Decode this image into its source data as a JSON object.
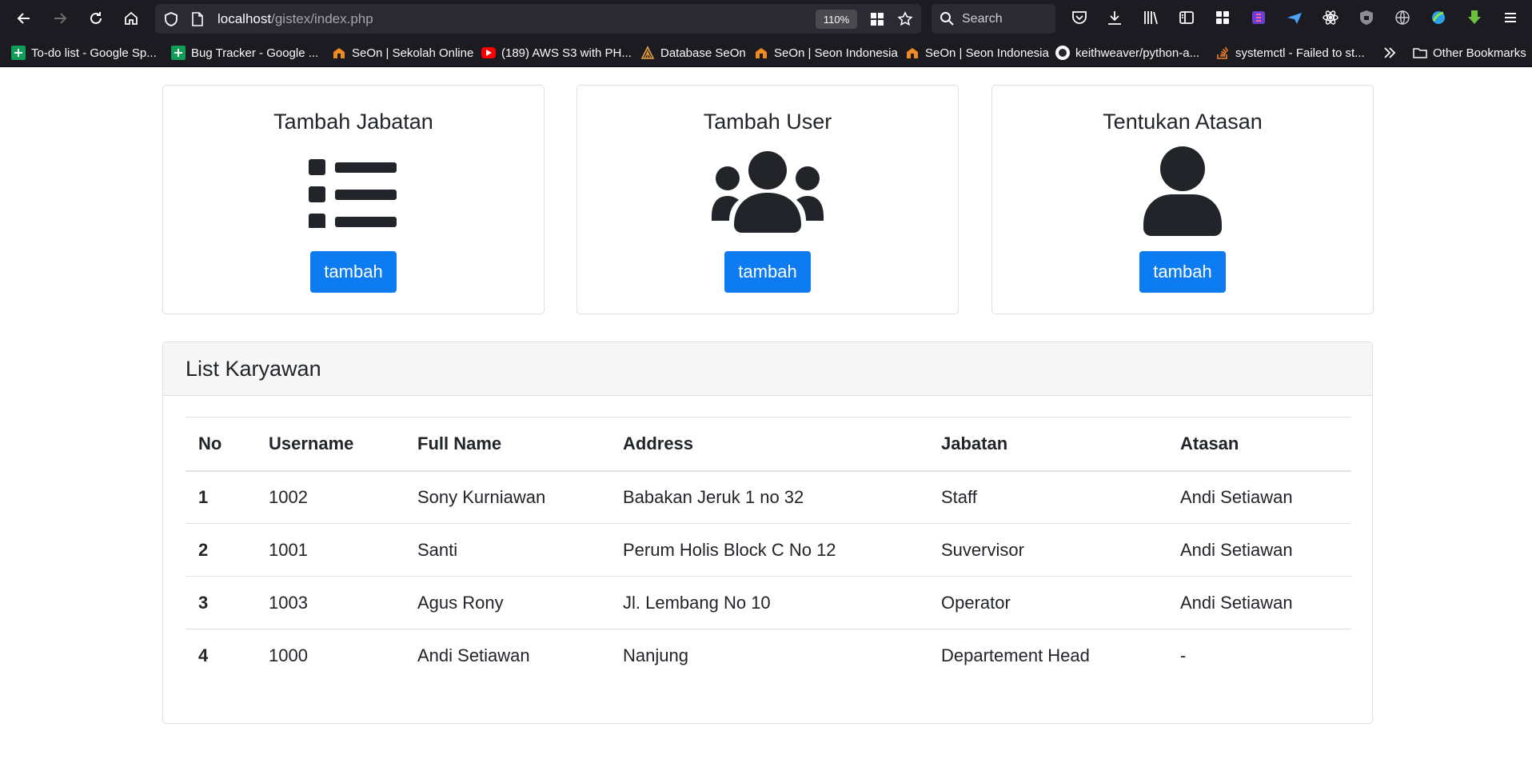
{
  "browser": {
    "url_host": "localhost",
    "url_path": "/gistex/index.php",
    "zoom": "110%",
    "search_placeholder": "Search",
    "bookmarks": [
      {
        "label": "To-do list - Google Sp...",
        "icon": "google-sheets-icon",
        "color": "#0f9d58"
      },
      {
        "label": "Bug Tracker - Google ...",
        "icon": "google-sheets-icon",
        "color": "#0f9d58"
      },
      {
        "label": "SeOn | Sekolah Online",
        "icon": "seon-icon",
        "color": "#f08a24"
      },
      {
        "label": "(189) AWS S3 with PH...",
        "icon": "youtube-icon",
        "color": "#ff0000"
      },
      {
        "label": "Database SeOn",
        "icon": "database-icon",
        "color": "#e8a33a"
      },
      {
        "label": "SeOn | Seon Indonesia",
        "icon": "seon-icon",
        "color": "#f08a24"
      },
      {
        "label": "SeOn | Seon Indonesia",
        "icon": "seon-icon",
        "color": "#f08a24"
      },
      {
        "label": "keithweaver/python-a...",
        "icon": "github-icon",
        "color": "#24292e"
      },
      {
        "label": "systemctl - Failed to st...",
        "icon": "stackoverflow-icon",
        "color": "#f48024"
      }
    ],
    "other_bookmarks": "Other Bookmarks"
  },
  "actions": [
    {
      "title": "Tambah Jabatan",
      "icon": "list-icon",
      "button": "tambah"
    },
    {
      "title": "Tambah User",
      "icon": "users-icon",
      "button": "tambah"
    },
    {
      "title": "Tentukan Atasan",
      "icon": "user-icon",
      "button": "tambah"
    }
  ],
  "list": {
    "title": "List Karyawan",
    "columns": [
      "No",
      "Username",
      "Full Name",
      "Address",
      "Jabatan",
      "Atasan"
    ],
    "rows": [
      [
        "1",
        "1002",
        "Sony Kurniawan",
        "Babakan Jeruk 1 no 32",
        "Staff",
        "Andi Setiawan"
      ],
      [
        "2",
        "1001",
        "Santi",
        "Perum Holis Block C No 12",
        "Suvervisor",
        "Andi Setiawan"
      ],
      [
        "3",
        "1003",
        "Agus Rony",
        "Jl. Lembang No 10",
        "Operator",
        "Andi Setiawan"
      ],
      [
        "4",
        "1000",
        "Andi Setiawan",
        "Nanjung",
        "Departement Head",
        "-"
      ]
    ]
  },
  "colors": {
    "primary_button": "#0d7cf2",
    "icon_dark": "#212529",
    "browser_bg": "#1c1b22"
  }
}
